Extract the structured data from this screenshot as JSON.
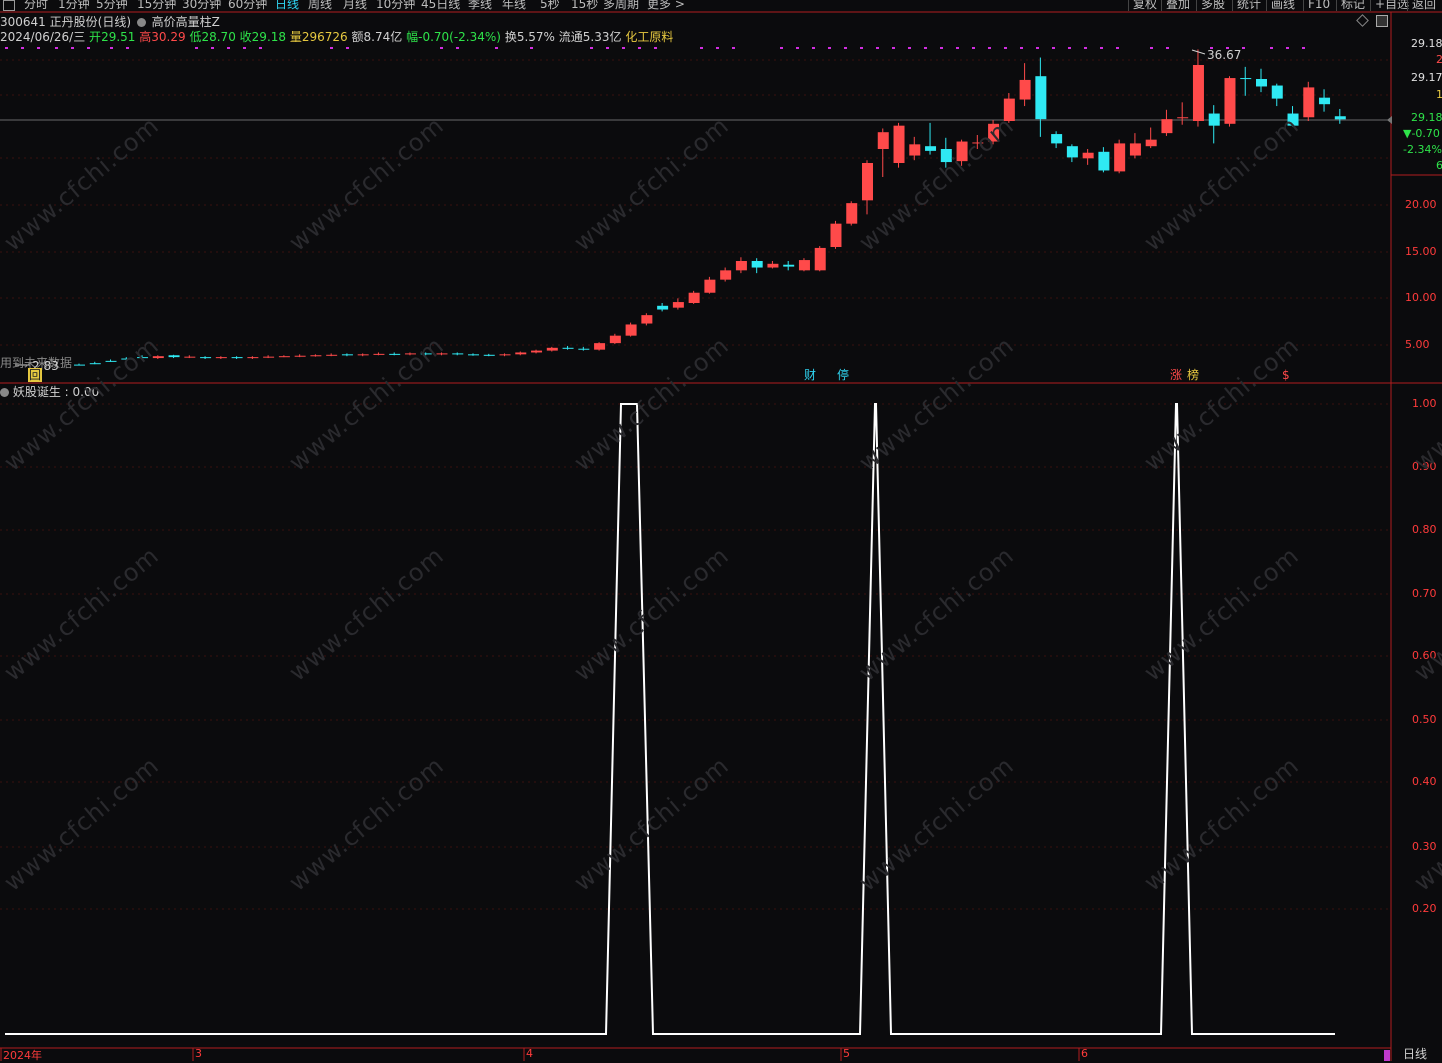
{
  "toolbar": {
    "periods": [
      "分时",
      "1分钟",
      "5分钟",
      "15分钟",
      "30分钟",
      "60分钟",
      "日线",
      "周线",
      "月线",
      "10分钟",
      "45日线",
      "季线",
      "年线",
      "5秒",
      "15秒",
      "多周期",
      "更多 >"
    ],
    "active_period": "日线",
    "right_buttons": [
      "复权",
      "叠加",
      "多股",
      "统计",
      "画线",
      "F10",
      "标记",
      "+自选",
      "返回"
    ]
  },
  "stock": {
    "code": "300641",
    "name": "正丹股份(日线)",
    "indicator": "高价高量柱Z"
  },
  "quote": {
    "date": "2024/06/26/三",
    "open_label": "开",
    "open": "29.51",
    "high_label": "高",
    "high": "30.29",
    "low_label": "低",
    "low": "28.70",
    "close_label": "收",
    "close": "29.18",
    "volume_label": "量",
    "volume": "296726",
    "amount_label": "额",
    "amount": "8.74亿",
    "change_label": "幅",
    "change": "-0.70(-2.34%)",
    "turnover_label": "换",
    "turnover": "5.57%",
    "float_label": "流通",
    "float": "5.33亿",
    "sector": "化工原料"
  },
  "price_axis": {
    "labels": [
      "20.00",
      "15.00",
      "10.00",
      "5.00"
    ],
    "top_price": "29.18",
    "top_price2": "29.17",
    "current": "29.18",
    "change": "▼-0.70",
    "change_pct": "-2.34%",
    "small_marks": [
      "2",
      "1",
      "6"
    ]
  },
  "annotations": {
    "high_marker": "36.67",
    "low_marker": "2.83",
    "left_note": "用到未来数据",
    "return_badge": "回"
  },
  "signals": [
    {
      "text": "财",
      "color": "#2fd4f0"
    },
    {
      "text": "停",
      "color": "#2fd4f0"
    },
    {
      "text": "涨",
      "color": "#ff4a4a"
    },
    {
      "text": "榜",
      "color": "#e6c840"
    },
    {
      "text": "$",
      "color": "#ff4a4a"
    }
  ],
  "indicator_panel": {
    "title": "妖股诞生",
    "value": "0.00",
    "y_labels": [
      "1.00",
      "0.90",
      "0.80",
      "0.70",
      "0.60",
      "0.50",
      "0.40",
      "0.30",
      "0.20"
    ]
  },
  "x_axis": {
    "labels": [
      "2024年",
      "3",
      "4",
      "5",
      "6"
    ]
  },
  "footer": {
    "period": "日线"
  },
  "watermark": "www.cfchi.com",
  "colors": {
    "up": "#ff4a4a",
    "down": "#2fe9f3",
    "line": "#ffffff",
    "dot": "#d22ee0",
    "accent": "#2fd4f0"
  },
  "chart_data": {
    "type": "line",
    "title": "妖股诞生",
    "x": [
      "2024-01",
      "2024-03",
      "2024-04",
      "2024-05",
      "2024-06"
    ],
    "series": [
      {
        "name": "妖股诞生",
        "peaks_at_index": [
          42,
          58,
          78
        ],
        "peak_value": 1.0,
        "base_value": 0.0
      }
    ],
    "ylim": [
      0,
      1.0
    ]
  },
  "candles": [
    [
      2.9,
      2.85,
      3.0,
      2.83
    ],
    [
      3.05,
      3.0,
      3.2,
      2.95
    ],
    [
      3.3,
      3.25,
      3.45,
      3.2
    ],
    [
      3.55,
      3.45,
      3.7,
      3.4
    ],
    [
      3.7,
      3.6,
      3.9,
      3.5
    ],
    [
      3.6,
      3.8,
      3.9,
      3.5
    ],
    [
      3.9,
      3.7,
      3.95,
      3.6
    ],
    [
      3.7,
      3.75,
      3.9,
      3.6
    ],
    [
      3.7,
      3.6,
      3.8,
      3.5
    ],
    [
      3.6,
      3.7,
      3.8,
      3.5
    ],
    [
      3.7,
      3.6,
      3.8,
      3.5
    ],
    [
      3.6,
      3.7,
      3.8,
      3.5
    ],
    [
      3.7,
      3.75,
      3.9,
      3.6
    ],
    [
      3.75,
      3.8,
      3.9,
      3.7
    ],
    [
      3.8,
      3.85,
      4.0,
      3.7
    ],
    [
      3.85,
      3.9,
      4.0,
      3.75
    ],
    [
      3.9,
      3.95,
      4.1,
      3.8
    ],
    [
      4.0,
      3.9,
      4.1,
      3.8
    ],
    [
      3.9,
      4.0,
      4.1,
      3.8
    ],
    [
      4.0,
      4.05,
      4.2,
      3.9
    ],
    [
      4.05,
      4.0,
      4.2,
      3.9
    ],
    [
      4.0,
      4.1,
      4.2,
      3.9
    ],
    [
      4.1,
      4.0,
      4.2,
      3.9
    ],
    [
      4.0,
      4.1,
      4.2,
      3.9
    ],
    [
      4.1,
      4.0,
      4.2,
      3.9
    ],
    [
      4.0,
      3.95,
      4.1,
      3.85
    ],
    [
      3.95,
      3.9,
      4.05,
      3.8
    ],
    [
      3.9,
      4.0,
      4.1,
      3.8
    ],
    [
      4.0,
      4.2,
      4.3,
      3.9
    ],
    [
      4.2,
      4.4,
      4.5,
      4.1
    ],
    [
      4.4,
      4.7,
      4.8,
      4.3
    ],
    [
      4.7,
      4.6,
      4.9,
      4.5
    ],
    [
      4.6,
      4.5,
      4.8,
      4.4
    ],
    [
      4.5,
      5.2,
      5.3,
      4.4
    ],
    [
      5.2,
      6.0,
      6.2,
      5.1
    ],
    [
      6.0,
      7.2,
      7.4,
      5.9
    ],
    [
      7.3,
      8.2,
      8.4,
      7.1
    ],
    [
      9.2,
      8.8,
      9.5,
      8.6
    ],
    [
      9.0,
      9.6,
      10.0,
      8.8
    ],
    [
      9.5,
      10.6,
      10.8,
      9.4
    ],
    [
      10.6,
      12.0,
      12.3,
      10.5
    ],
    [
      12.0,
      13.0,
      13.3,
      11.8
    ],
    [
      13.0,
      14.0,
      14.4,
      12.7
    ],
    [
      14.0,
      13.3,
      14.3,
      12.7
    ],
    [
      13.3,
      13.7,
      14.0,
      13.2
    ],
    [
      13.6,
      13.4,
      14.0,
      13.0
    ],
    [
      13.0,
      14.1,
      14.3,
      12.9
    ],
    [
      13.0,
      15.4,
      15.6,
      12.9
    ],
    [
      15.5,
      18.0,
      18.3,
      15.3
    ],
    [
      18.0,
      20.2,
      20.4,
      17.8
    ],
    [
      20.5,
      24.5,
      24.8,
      19.0
    ],
    [
      26.0,
      27.8,
      28.2,
      23.0
    ],
    [
      24.5,
      28.5,
      28.8,
      24.0
    ],
    [
      25.3,
      26.5,
      27.3,
      24.8
    ],
    [
      26.3,
      25.8,
      28.8,
      25.4
    ],
    [
      26.0,
      24.6,
      27.2,
      24.0
    ],
    [
      24.7,
      26.8,
      27.0,
      24.2
    ],
    [
      26.6,
      26.7,
      27.5,
      26.0
    ],
    [
      26.8,
      28.7,
      29.1,
      26.5
    ],
    [
      29.0,
      31.4,
      32.0,
      28.8
    ],
    [
      31.3,
      33.4,
      35.2,
      30.6
    ],
    [
      33.8,
      29.2,
      35.8,
      27.3
    ],
    [
      27.6,
      26.6,
      27.9,
      26.1
    ],
    [
      26.3,
      25.1,
      26.5,
      24.6
    ],
    [
      25.0,
      25.6,
      26.0,
      24.3
    ],
    [
      25.7,
      23.7,
      26.2,
      23.5
    ],
    [
      23.6,
      26.6,
      27.0,
      23.4
    ],
    [
      25.3,
      26.6,
      27.7,
      25.0
    ],
    [
      26.3,
      27.0,
      28.3,
      26.1
    ],
    [
      27.7,
      29.2,
      30.2,
      27.4
    ],
    [
      29.3,
      29.4,
      31.0,
      28.6
    ],
    [
      29.0,
      35.0,
      36.67,
      28.4
    ],
    [
      29.8,
      28.5,
      30.7,
      26.6
    ],
    [
      28.7,
      33.6,
      33.8,
      28.4
    ],
    [
      33.6,
      33.5,
      34.8,
      31.7
    ],
    [
      33.5,
      32.7,
      34.6,
      32.1
    ],
    [
      32.8,
      31.4,
      33.0,
      30.6
    ],
    [
      29.8,
      28.5,
      30.6,
      28.4
    ],
    [
      29.4,
      32.6,
      33.2,
      29.0
    ],
    [
      31.5,
      30.8,
      32.4,
      30.0
    ],
    [
      29.51,
      29.18,
      30.29,
      28.7
    ]
  ]
}
